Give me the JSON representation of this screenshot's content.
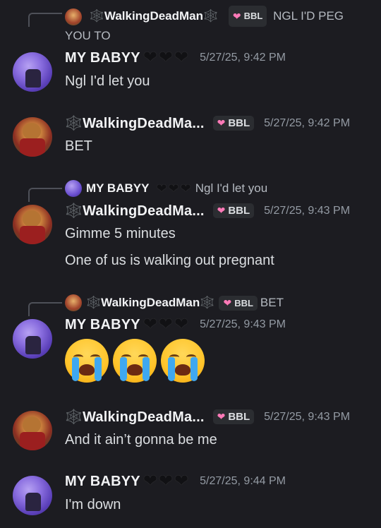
{
  "users": {
    "walking": "🕸️WalkingDeadMan🕸️",
    "walking_truncated": "🕸️WalkingDeadMa...",
    "baby": "MY BABYY"
  },
  "tag_label": "BBL",
  "messages": [
    {
      "reply_name": "🕸️WalkingDeadMan🕸️",
      "reply_text": "NGL I'D PEG YOU TO",
      "author": "MY BABYY",
      "timestamp": "5/27/25, 9:42 PM",
      "text": "Ngl I'd let you"
    },
    {
      "author": "🕸️WalkingDeadMa...",
      "timestamp": "5/27/25, 9:42 PM",
      "text": "BET"
    },
    {
      "reply_name": "MY BABYY",
      "reply_text": "Ngl I'd let you",
      "author": "🕸️WalkingDeadMa...",
      "timestamp": "5/27/25, 9:43 PM",
      "text": "Gimme 5 minutes",
      "text2": "One of us is walking out pregnant"
    },
    {
      "reply_name": "🕸️WalkingDeadMan🕸️",
      "reply_text": "BET",
      "author": "MY BABYY",
      "timestamp": "5/27/25, 9:43 PM",
      "emojis": [
        "😭",
        "😭",
        "😭"
      ]
    },
    {
      "author": "🕸️WalkingDeadMa...",
      "timestamp": "5/27/25, 9:43 PM",
      "text": "And it ain’t gonna be me"
    },
    {
      "author": "MY BABYY",
      "timestamp": "5/27/25, 9:44 PM",
      "text": "I'm down"
    }
  ],
  "icons": {
    "heart": "black-heart-icon",
    "web": "spider-web-icon",
    "tag_heart": "pink-heart-icon",
    "emoji": "loudly-crying-face-icon"
  },
  "colors": {
    "background": "#1c1c21",
    "username": "#f2f3f5",
    "timestamp": "#949ba4",
    "tag_bg": "#2b2d31",
    "tag_heart": "#ff7ab8"
  }
}
